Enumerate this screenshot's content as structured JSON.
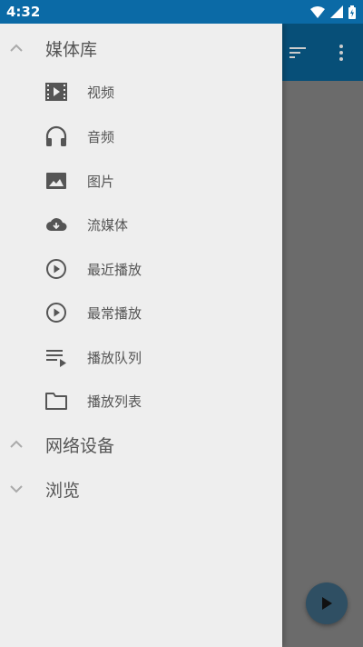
{
  "status_bar": {
    "time": "4:32"
  },
  "drawer": {
    "sections": [
      {
        "title": "媒体库",
        "expanded": true,
        "items": [
          {
            "label": "视频",
            "icon": "video-icon"
          },
          {
            "label": "音频",
            "icon": "headphones-icon"
          },
          {
            "label": "图片",
            "icon": "image-icon"
          },
          {
            "label": "流媒体",
            "icon": "cloud-download-icon"
          },
          {
            "label": "最近播放",
            "icon": "play-circle-icon"
          },
          {
            "label": "最常播放",
            "icon": "play-circle-icon"
          },
          {
            "label": "播放队列",
            "icon": "queue-icon"
          },
          {
            "label": "播放列表",
            "icon": "folder-icon"
          }
        ]
      },
      {
        "title": "网络设备",
        "expanded": true,
        "items": []
      },
      {
        "title": "浏览",
        "expanded": false,
        "items": []
      }
    ]
  },
  "toolbar": {
    "icons": [
      "sort-icon",
      "more-vert-icon"
    ]
  },
  "fab": {
    "icon": "play-icon"
  },
  "colors": {
    "status_bar": "#0b6aa6",
    "toolbar": "#074f78",
    "drawer_bg": "#eeeeee",
    "fab": "#2f4f63",
    "scrim": "#6b6b6b"
  }
}
